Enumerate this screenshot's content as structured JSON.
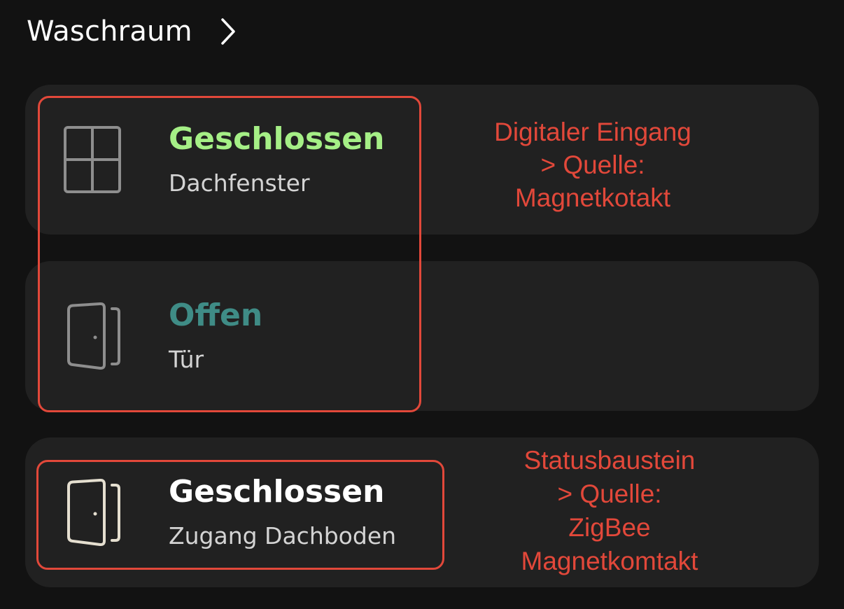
{
  "header": {
    "title": "Waschraum",
    "chevron_icon": "chevron-right-icon"
  },
  "cards": [
    {
      "icon": "window-icon",
      "status": "Geschlossen",
      "status_color": "#a5ef86",
      "label": "Dachfenster"
    },
    {
      "icon": "door-icon",
      "status": "Offen",
      "status_color": "#3f8c86",
      "label": "Tür"
    },
    {
      "icon": "door-icon",
      "status": "Geschlossen",
      "status_color": "#ffffff",
      "label": "Zugang Dachboden"
    }
  ],
  "annotations": [
    {
      "text": "Digitaler Eingang\n> Quelle:\nMagnetkotakt"
    },
    {
      "text": "Statusbaustein\n> Quelle:\nZigBee\nMagnetkomtakt"
    }
  ],
  "colors": {
    "background": "#121212",
    "card": "#212121",
    "annotation": "#e2483a",
    "icon_gray": "#8e8e8e",
    "icon_beige": "#e5dfd0"
  }
}
